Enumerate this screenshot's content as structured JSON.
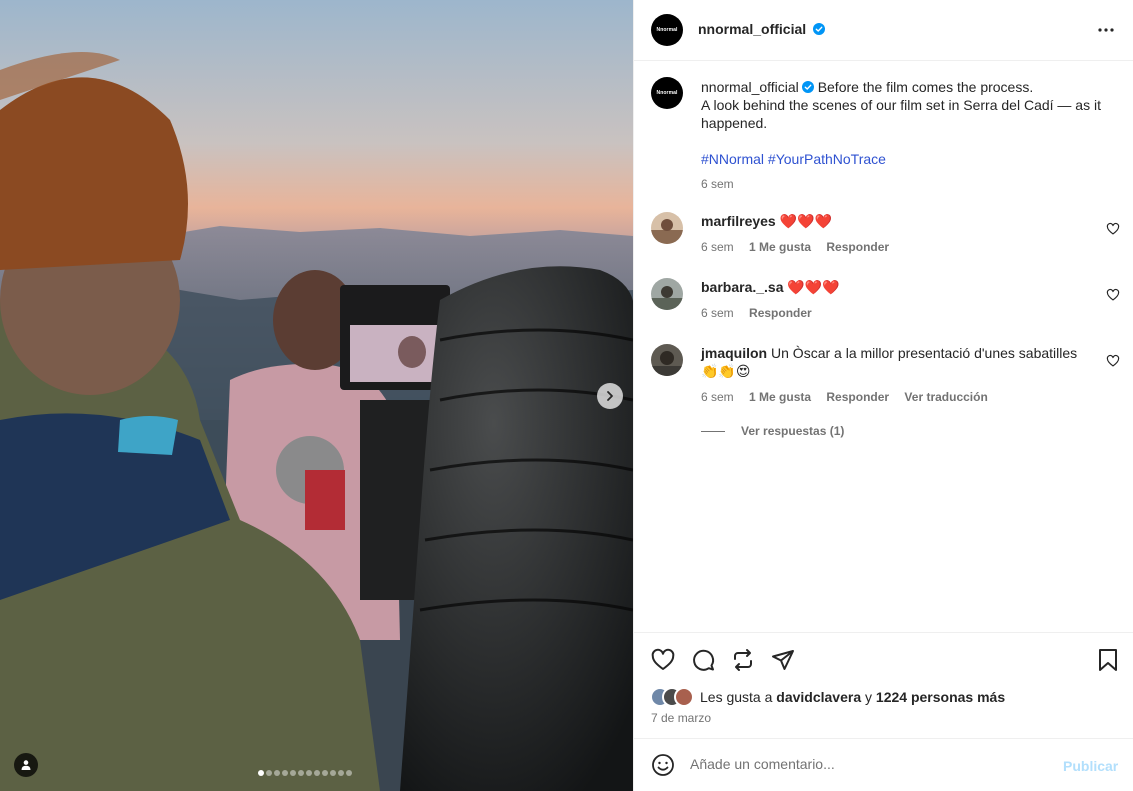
{
  "post": {
    "username": "nnormal_official",
    "logo_text": "Nnormal"
  },
  "caption": {
    "username": "nnormal_official",
    "line1": "Before the film comes the process.",
    "line2": "A look behind the scenes of our film set in Serra del Cadí — as it happened.",
    "hashtag1": "#NNormal",
    "hashtag2": "#YourPathNoTrace",
    "time": "6 sem"
  },
  "comments": [
    {
      "username": "marfilreyes",
      "text": "❤️❤️❤️",
      "time": "6 sem",
      "likes": "1 Me gusta",
      "reply": "Responder"
    },
    {
      "username": "barbara._.sa",
      "text": "❤️❤️❤️",
      "time": "6 sem",
      "reply": "Responder"
    },
    {
      "username": "jmaquilon",
      "text": "Un Òscar a la millor presentació d'unes sabatilles 👏👏😍",
      "time": "6 sem",
      "likes": "1 Me gusta",
      "reply": "Responder",
      "translate": "Ver traducción",
      "view_replies": "Ver respuestas (1)"
    }
  ],
  "likes": {
    "prefix": "Les gusta a",
    "user": "davidclavera",
    "conj": "y",
    "others": "1224 personas más"
  },
  "date": "7 de marzo",
  "add_comment": {
    "placeholder": "Añade un comentario...",
    "publish": "Publicar"
  },
  "carousel": {
    "count": 12,
    "active_index": 0
  },
  "colors": {
    "verified": "#0095f6",
    "link": "#2f52d1",
    "publish_disabled": "#b2dffc"
  }
}
